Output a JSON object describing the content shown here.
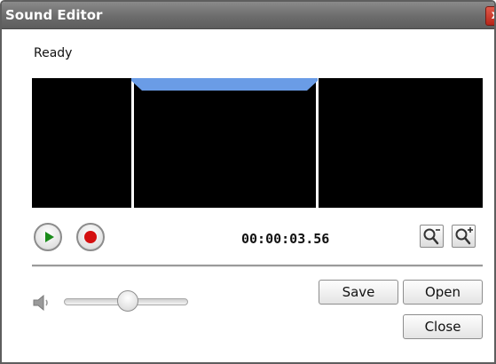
{
  "window": {
    "title": "Sound Editor",
    "close_glyph": "x"
  },
  "status": "Ready",
  "waveform": {
    "selection_color": "#6a9ce6",
    "wave_color": "#e8101c",
    "background_color": "#000000"
  },
  "transport": {
    "play_icon": "play-icon",
    "record_icon": "record-icon",
    "time": "00:00:03.56"
  },
  "zoom": {
    "zoom_out_icon": "zoom-out-icon",
    "zoom_in_icon": "zoom-in-icon"
  },
  "volume": {
    "speaker_icon": "speaker-icon",
    "level": 0.5
  },
  "buttons": {
    "save": "Save",
    "open": "Open",
    "close": "Close"
  }
}
